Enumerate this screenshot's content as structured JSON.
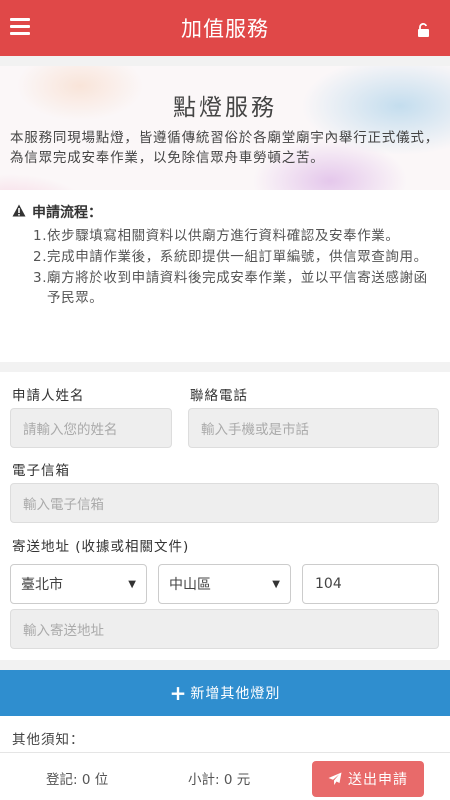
{
  "header": {
    "title": "加值服務",
    "menu_icon": "hamburger-menu-icon",
    "lock_icon": "unlock-icon",
    "brand_color": "#e04848"
  },
  "hero": {
    "title": "點燈服務",
    "description": "本服務同現場點燈，皆遵循傳統習俗於各廟堂廟宇內舉行正式儀式，為信眾完成安奉作業，以免除信眾舟車勞頓之苦。"
  },
  "process": {
    "heading": "申請流程：",
    "steps": [
      {
        "num": "1.",
        "text": "依步驟填寫相關資料以供廟方進行資料確認及安奉作業。"
      },
      {
        "num": "2.",
        "text": "完成申請作業後，系統即提供一組訂單編號，供信眾查詢用。"
      },
      {
        "num": "3.",
        "text": "廟方將於收到申請資料後完成安奉作業，並以平信寄送感謝函予民眾。"
      }
    ]
  },
  "form": {
    "name_label": "申請人姓名",
    "name_placeholder": "請輸入您的姓名",
    "phone_label": "聯絡電話",
    "phone_placeholder": "輸入手機或是市話",
    "email_label": "電子信箱",
    "email_placeholder": "輸入電子信箱",
    "address_label": "寄送地址 (收據或相關文件)",
    "city_value": "臺北市",
    "district_value": "中山區",
    "zip_value": "104",
    "address_placeholder": "輸入寄送地址"
  },
  "add_button": {
    "label": "新增其他燈別",
    "color": "#2f8ecf"
  },
  "notes": {
    "label": "其他須知："
  },
  "footer": {
    "registered": "登記: 0 位",
    "subtotal": "小計: 0 元",
    "submit_label": "送出申請",
    "submit_color": "#e86a6a"
  }
}
